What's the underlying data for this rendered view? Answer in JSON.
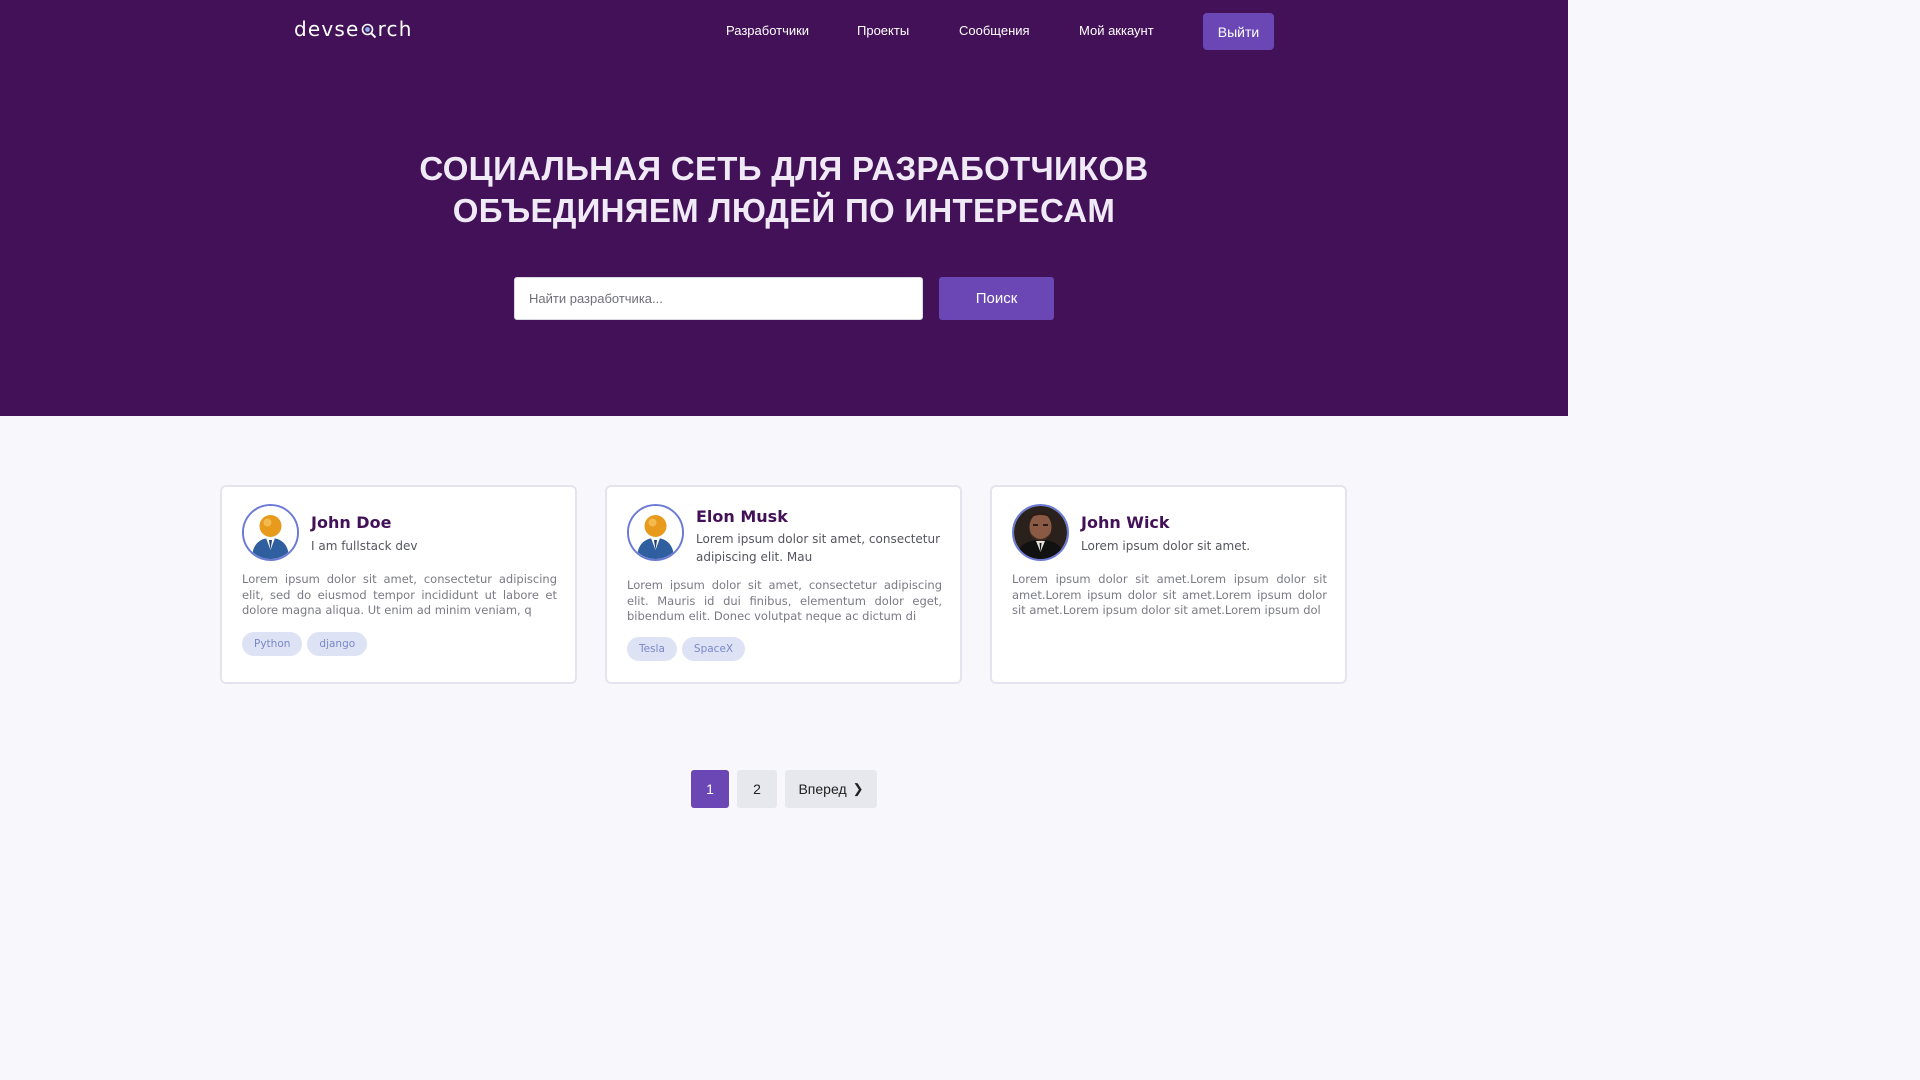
{
  "header": {
    "logo_text_before": "devse",
    "logo_text_after": "rch",
    "nav": [
      "Разработчики",
      "Проекты",
      "Сообщения",
      "Мой аккаунт"
    ],
    "logout_label": "Выйти"
  },
  "hero": {
    "line1_regular": "СОЦИАЛЬНАЯ СЕТЬ ДЛЯ ",
    "line1_bold": "РАЗРАБОТЧИКОВ",
    "line2": "ОБЪЕДИНЯЕМ ЛЮДЕЙ ПО ИНТЕРЕСАМ"
  },
  "search": {
    "placeholder": "Найти разработчика...",
    "value": "",
    "button_label": "Поиск"
  },
  "developers": [
    {
      "name": "John Doe",
      "short_intro": "I am fullstack dev",
      "bio": "Lorem ipsum dolor sit amet, consectetur adipiscing elit, sed do eiusmod tempor incididunt ut labore et dolore magna aliqua. Ut enim ad minim veniam, q",
      "avatar": "default-user-avatar",
      "skills": [
        "Python",
        "django"
      ]
    },
    {
      "name": "Elon Musk",
      "short_intro": "Lorem ipsum dolor sit amet, consectetur adipiscing elit. Mau",
      "bio": "Lorem ipsum dolor sit amet, consectetur adipiscing elit. Mauris id dui finibus, elementum dolor eget, bibendum elit. Donec volutpat neque ac dictum di",
      "avatar": "default-user-avatar",
      "skills": [
        "Tesla",
        "SpaceX"
      ]
    },
    {
      "name": "John Wick",
      "short_intro": "Lorem ipsum dolor sit amet.",
      "bio": "Lorem ipsum dolor sit amet.Lorem ipsum dolor sit amet.Lorem ipsum dolor sit amet.Lorem ipsum dolor sit amet.Lorem ipsum dolor sit amet.Lorem ipsum dol",
      "avatar": "photo-avatar",
      "skills": []
    }
  ],
  "pagination": {
    "pages": [
      "1",
      "2"
    ],
    "current": "1",
    "next_label": "Вперед",
    "next_arrow": "❯"
  },
  "colors": {
    "hero_bg": "#431157",
    "accent": "#6b47b5",
    "tag_bg": "#dde3f5",
    "tag_text": "#7a88c9",
    "name_text": "#431157"
  }
}
